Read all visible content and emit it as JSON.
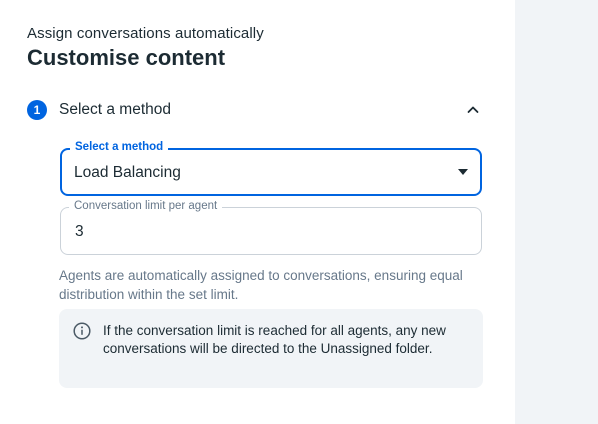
{
  "header": {
    "subtitle": "Assign conversations automatically",
    "title": "Customise content"
  },
  "step": {
    "number": "1",
    "label": "Select a method",
    "collapse_icon": "chevron-up-icon"
  },
  "method_select": {
    "legend": "Select a method",
    "value": "Load Balancing",
    "icon": "dropdown-caret-icon"
  },
  "limit_field": {
    "legend": "Conversation limit per agent",
    "value": "3"
  },
  "helper_text": "Agents are automatically assigned to conversations, ensuring equal distribution within the set limit.",
  "info": {
    "icon": "info-circle-icon",
    "text": "If the conversation limit is reached for all agents, any new conversations will be directed to the Unassigned folder."
  },
  "colors": {
    "accent": "#0064e0",
    "text": "#1c2b33",
    "muted": "#67788a",
    "panel": "#f1f4f7"
  }
}
